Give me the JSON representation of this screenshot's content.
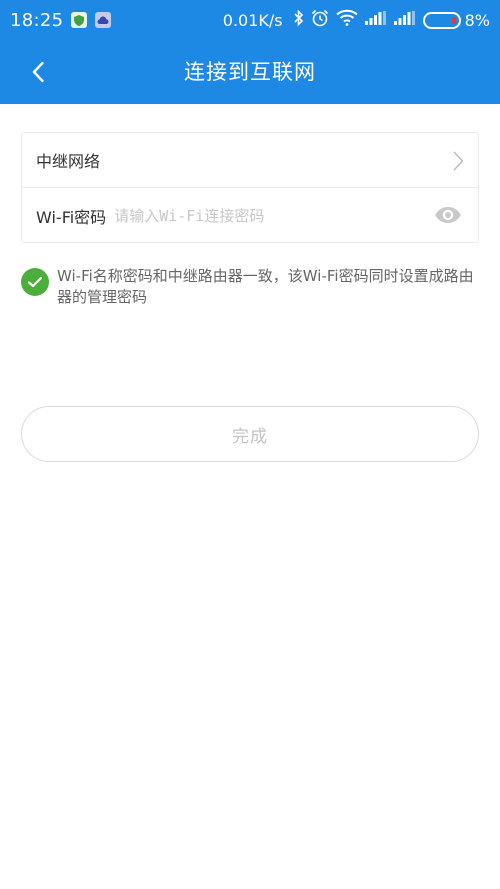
{
  "status_bar": {
    "time": "18:25",
    "net_speed": "0.01K/s",
    "battery_pct": "8%",
    "icons": [
      "shield-app-icon",
      "cloud-app-icon",
      "bluetooth-icon",
      "alarm-icon",
      "wifi-icon",
      "signal-icon",
      "signal-icon-2",
      "battery-icon"
    ]
  },
  "header": {
    "title": "连接到互联网",
    "color": "#1e88e5"
  },
  "form": {
    "relay_network_label": "中继网络",
    "wifi_password_label": "Wi-Fi密码",
    "wifi_password_placeholder": "请输入Wi-Fi连接密码",
    "wifi_password_value": ""
  },
  "option": {
    "checked": true,
    "text": "Wi-Fi名称密码和中继路由器一致，该Wi-Fi密码同时设置成路由器的管理密码",
    "check_color": "#4cae3a"
  },
  "actions": {
    "done_label": "完成"
  }
}
